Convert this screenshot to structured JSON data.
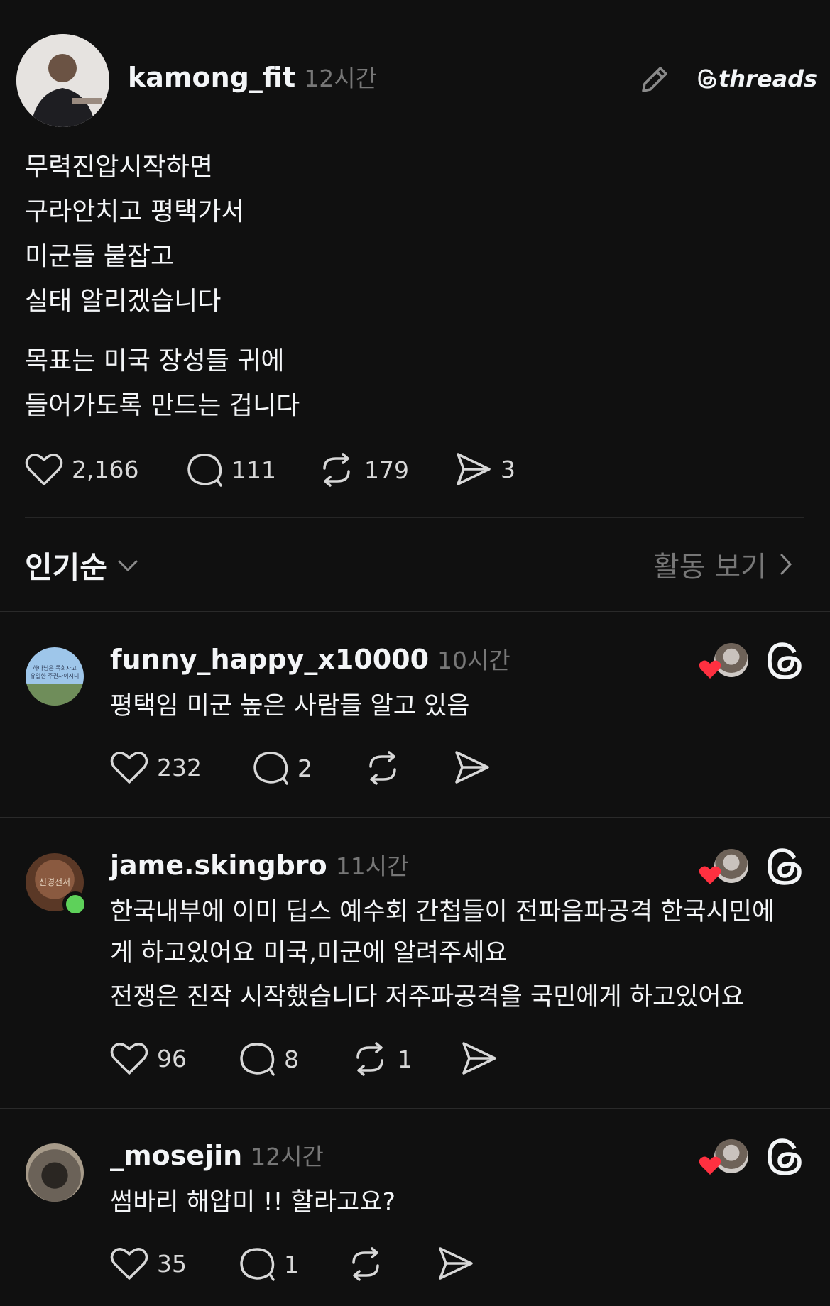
{
  "post": {
    "username": "kamong_fit",
    "time": "12시간",
    "brand": "threads",
    "lines": [
      "무력진압시작하면",
      "구라안치고 평택가서",
      "미군들 붙잡고",
      "실태 알리겠습니다"
    ],
    "lines2": [
      "목표는 미국 장성들 귀에",
      "들어가도록 만드는 겁니다"
    ],
    "likes": "2,166",
    "replies": "111",
    "reposts": "179",
    "shares": "3"
  },
  "sort": {
    "label": "인기순",
    "activity_label": "활동 보기"
  },
  "comments": [
    {
      "username": "funny_happy_x10000",
      "time": "10시간",
      "lines": [
        "평택임 미군 높은 사람들 알고 있음"
      ],
      "likes": "232",
      "replies": "2",
      "reposts": "",
      "avatar_text": [
        "하나님은 목회자고",
        "유일한 주권자이시니"
      ]
    },
    {
      "username": "jame.skingbro",
      "time": "11시간",
      "lines": [
        "한국내부에 이미 딥스 예수회 간첩들이 전파음파공격 한국시민에",
        "게 하고있어요 미국,미군에 알려주세요",
        "전쟁은 진작 시작했습니다 저주파공격을 국민에게 하고있어요"
      ],
      "likes": "96",
      "replies": "8",
      "reposts": "1",
      "avatar_text": [
        "신경전서"
      ]
    },
    {
      "username": "_mosejin",
      "time": "12시간",
      "lines": [
        "썸바리 해압미 !! 할라고요?"
      ],
      "likes": "35",
      "replies": "1",
      "reposts": ""
    }
  ],
  "colors": {
    "background": "#101010",
    "text": "#f3f5f7",
    "muted": "#777777",
    "heart_red": "#ff3040",
    "online_green": "#5ed15a"
  }
}
